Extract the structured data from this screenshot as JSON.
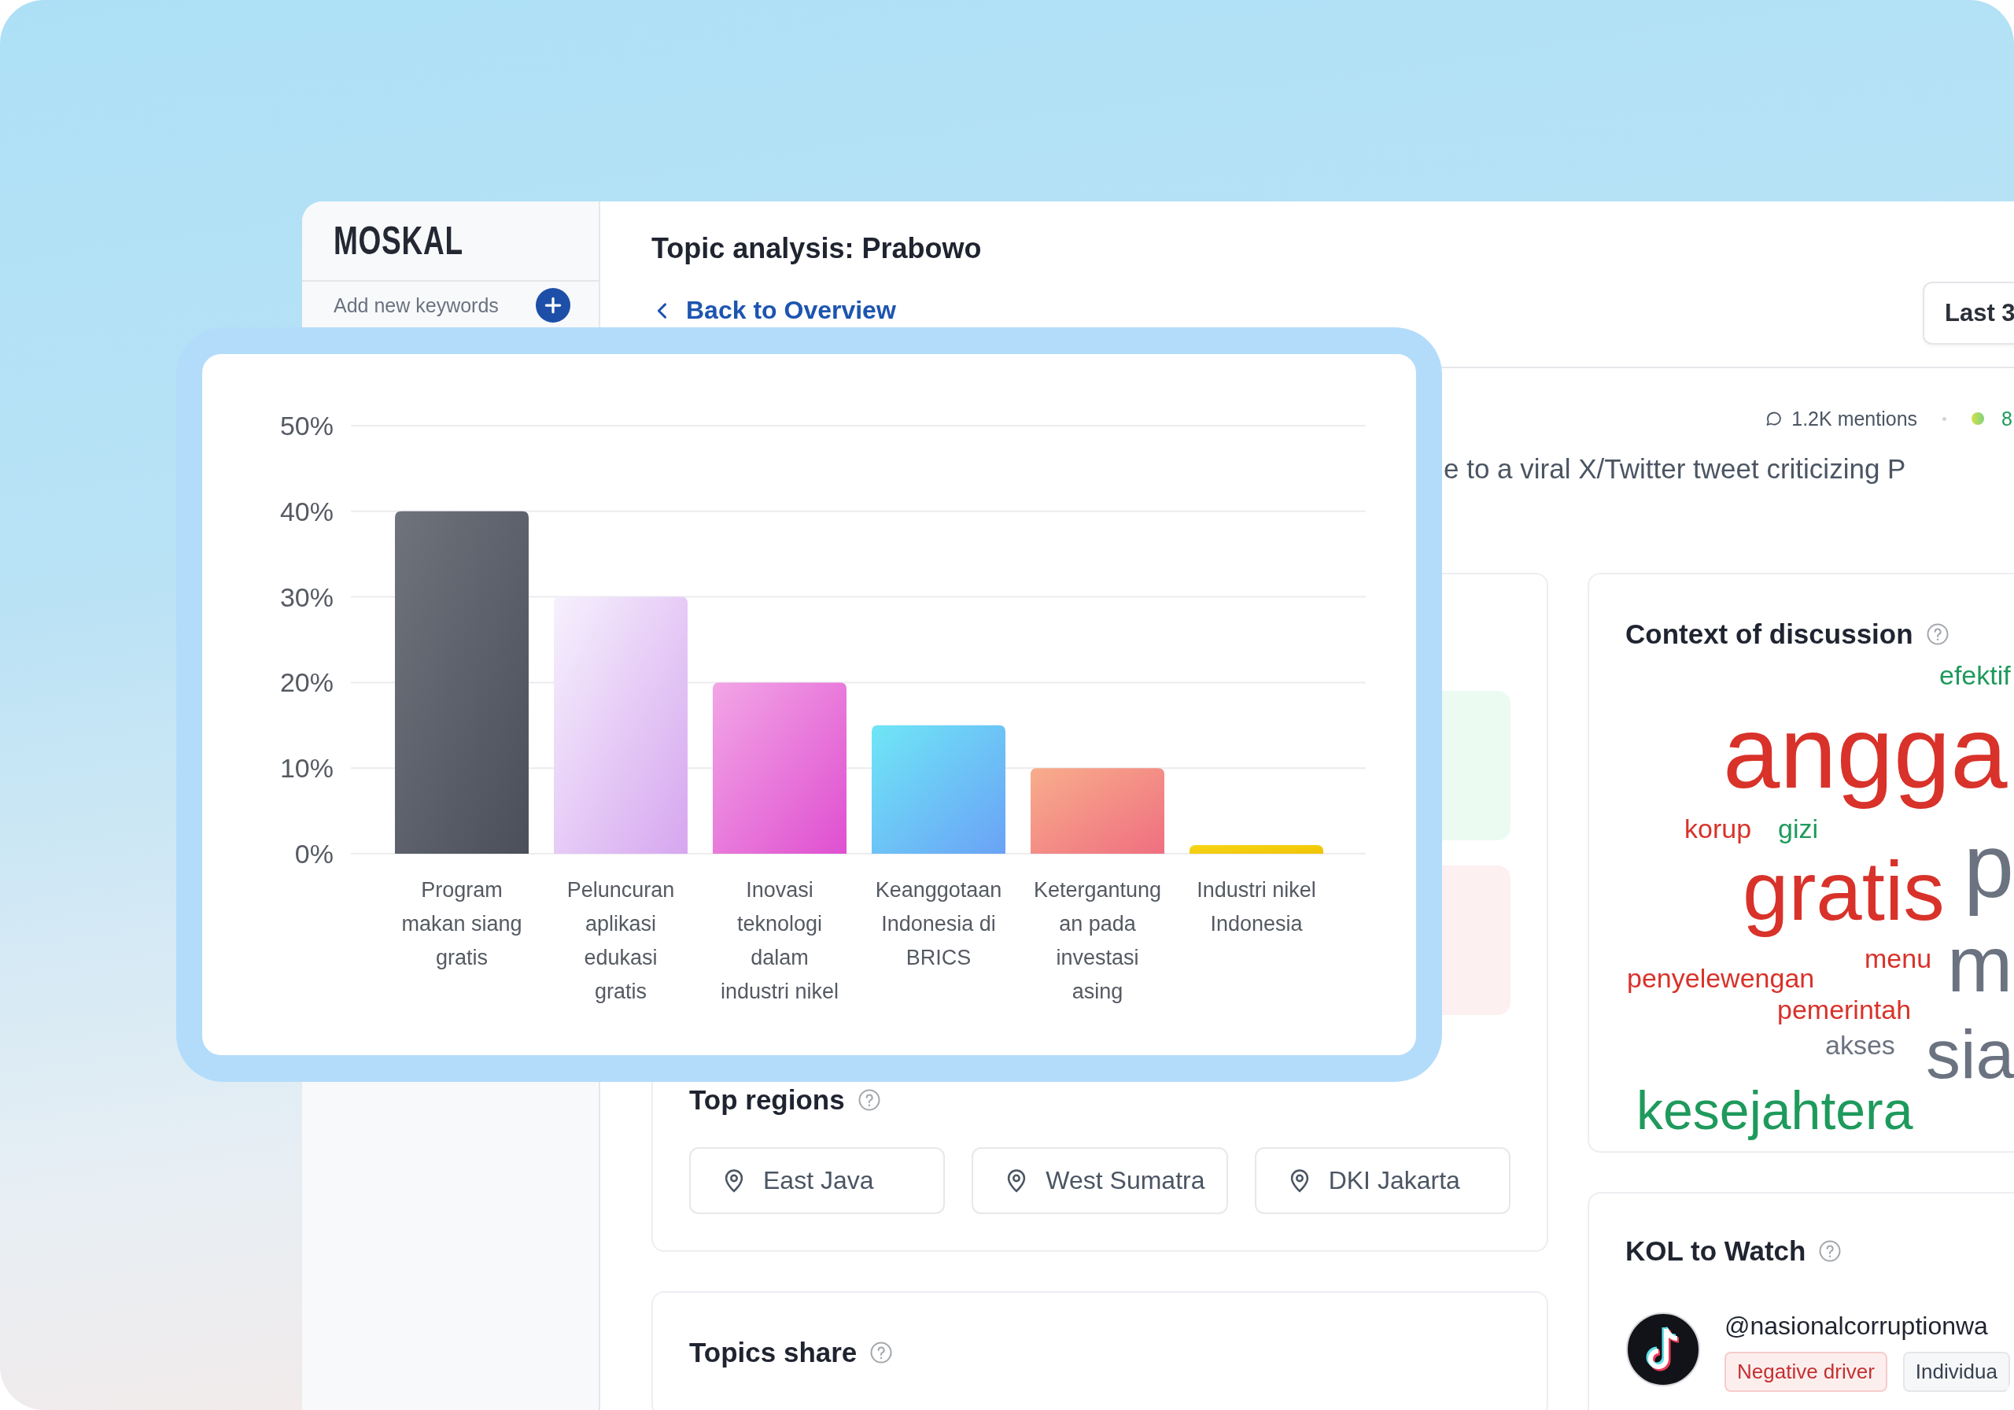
{
  "sidebar": {
    "logo": "MOSKAL",
    "add_keywords": "Add new keywords"
  },
  "header": {
    "title": "Topic analysis: Prabowo",
    "back_link": "Back to Overview",
    "date_button": "Last 3"
  },
  "summary": {
    "mentions": "1.2K mentions",
    "sentiment_value": "8",
    "description": "e to a viral X/Twitter tweet criticizing P"
  },
  "top_regions": {
    "title": "Top regions",
    "regions": [
      "East Java",
      "West Sumatra",
      "DKI Jakarta"
    ]
  },
  "topics_share": {
    "title": "Topics share"
  },
  "context": {
    "title": "Context of discussion",
    "words": [
      {
        "text": "efektif",
        "color": "#1e9a5c"
      },
      {
        "text": "angga",
        "color": "#d8322a"
      },
      {
        "text": "korup",
        "color": "#d8322a"
      },
      {
        "text": "gizi",
        "color": "#1e9a5c"
      },
      {
        "text": "gratis",
        "color": "#d8322a"
      },
      {
        "text": "p",
        "color": "#6b7280"
      },
      {
        "text": "menu",
        "color": "#d8322a"
      },
      {
        "text": "penyelewengan",
        "color": "#d8322a"
      },
      {
        "text": "m",
        "color": "#6b7280"
      },
      {
        "text": "pemerintah",
        "color": "#d8322a"
      },
      {
        "text": "akses",
        "color": "#6b7280"
      },
      {
        "text": "sia",
        "color": "#6b7280"
      },
      {
        "text": "kesejahtera",
        "color": "#1e9a5c"
      }
    ]
  },
  "kol": {
    "title": "KOL to Watch",
    "handle": "@nasionalcorruptionwa",
    "tags": [
      {
        "label": "Negative driver",
        "kind": "negative"
      },
      {
        "label": "Individua",
        "kind": "neutral"
      }
    ]
  },
  "overlay_chart": {
    "chart_data": {
      "type": "bar",
      "grid": true,
      "categories": [
        "Program makan siang gratis",
        "Peluncuran aplikasi edukasi gratis",
        "Inovasi teknologi dalam industri nikel",
        "Keanggotaan Indonesia di BRICS",
        "Ketergantungan pada investasi asing",
        "Industri nikel Indonesia"
      ],
      "values": [
        40,
        30,
        20,
        15,
        10,
        1
      ],
      "ylim": [
        0,
        50
      ],
      "yticks": [
        {
          "value": 0,
          "label": "0%"
        },
        {
          "value": 10,
          "label": "10%"
        },
        {
          "value": 20,
          "label": "20%"
        },
        {
          "value": 30,
          "label": "30%"
        },
        {
          "value": 40,
          "label": "40%"
        },
        {
          "value": 50,
          "label": "50%"
        }
      ]
    }
  }
}
